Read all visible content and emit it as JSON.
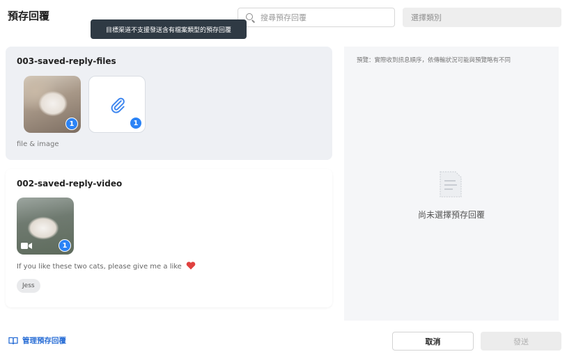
{
  "header": {
    "title": "預存回覆",
    "search_placeholder": "搜尋預存回覆",
    "category_placeholder": "選擇類別"
  },
  "tooltip": {
    "text": "目標渠道不支援發送含有檔案類型的預存回覆"
  },
  "replies": [
    {
      "name": "003-saved-reply-files",
      "attachments": [
        {
          "kind": "image",
          "count": "1"
        },
        {
          "kind": "file",
          "icon": "paperclip-icon",
          "count": "1"
        }
      ],
      "description": "file & image"
    },
    {
      "name": "002-saved-reply-video",
      "attachments": [
        {
          "kind": "video",
          "icon": "video-camera-icon",
          "count": "1"
        }
      ],
      "description": "If you like these two cats, please give me a like",
      "tag": "Jess"
    }
  ],
  "preview": {
    "note": "預覽：實際收到訊息順序，依傳輸狀況可能與預覽略有不同",
    "empty_text": "尚未選擇預存回覆"
  },
  "footer": {
    "manage_label": "管理預存回覆",
    "cancel_label": "取消",
    "send_label": "發送"
  },
  "colors": {
    "accent": "#2b83f6",
    "link": "#2b6fd6",
    "tooltip_bg": "#2f3a44",
    "selected_card_bg": "#eef0f4",
    "heart": "#e0413f"
  }
}
